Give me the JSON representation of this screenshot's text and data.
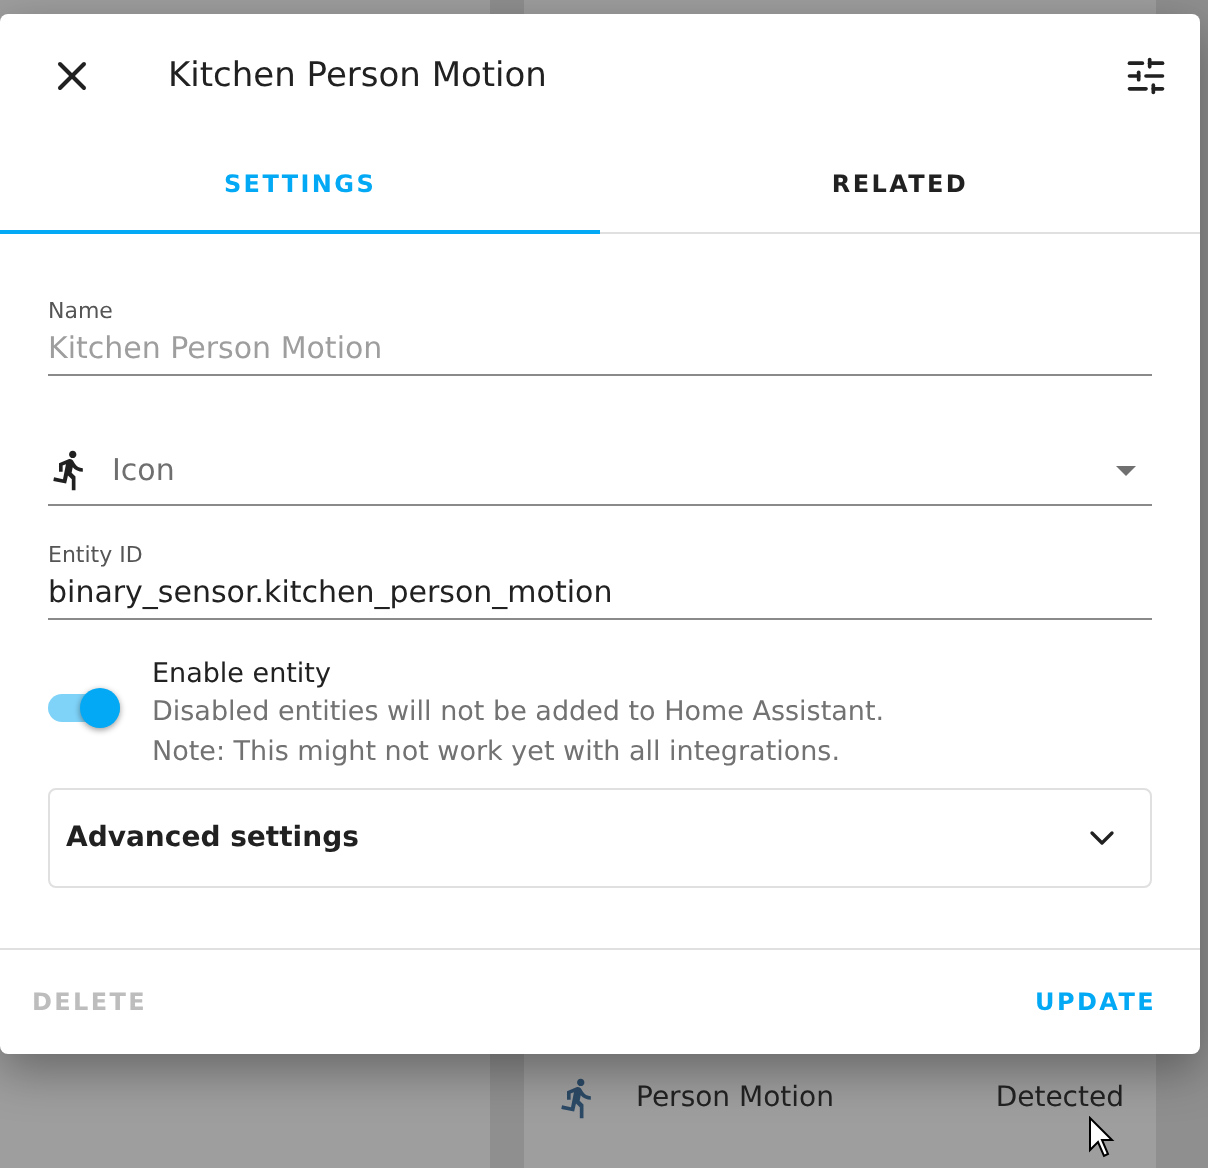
{
  "background": {
    "entity_row": {
      "name": "Person Motion",
      "state": "Detected"
    }
  },
  "dialog": {
    "title": "Kitchen Person Motion",
    "tabs": [
      {
        "label": "SETTINGS",
        "selected": true
      },
      {
        "label": "RELATED",
        "selected": false
      }
    ],
    "name_field": {
      "label": "Name",
      "value": "Kitchen Person Motion",
      "disabled": true
    },
    "icon_field": {
      "placeholder": "Icon"
    },
    "entity_id_field": {
      "label": "Entity ID",
      "value": "binary_sensor.kitchen_person_motion"
    },
    "enable_toggle": {
      "label": "Enable entity",
      "on": true,
      "description": [
        "Disabled entities will not be added to Home Assistant.",
        "Note: This might not work yet with all integrations."
      ]
    },
    "advanced": {
      "label": "Advanced settings",
      "expanded": false
    },
    "buttons": [
      {
        "label": "DELETE",
        "disabled": true
      },
      {
        "label": "UPDATE",
        "disabled": false
      }
    ]
  }
}
